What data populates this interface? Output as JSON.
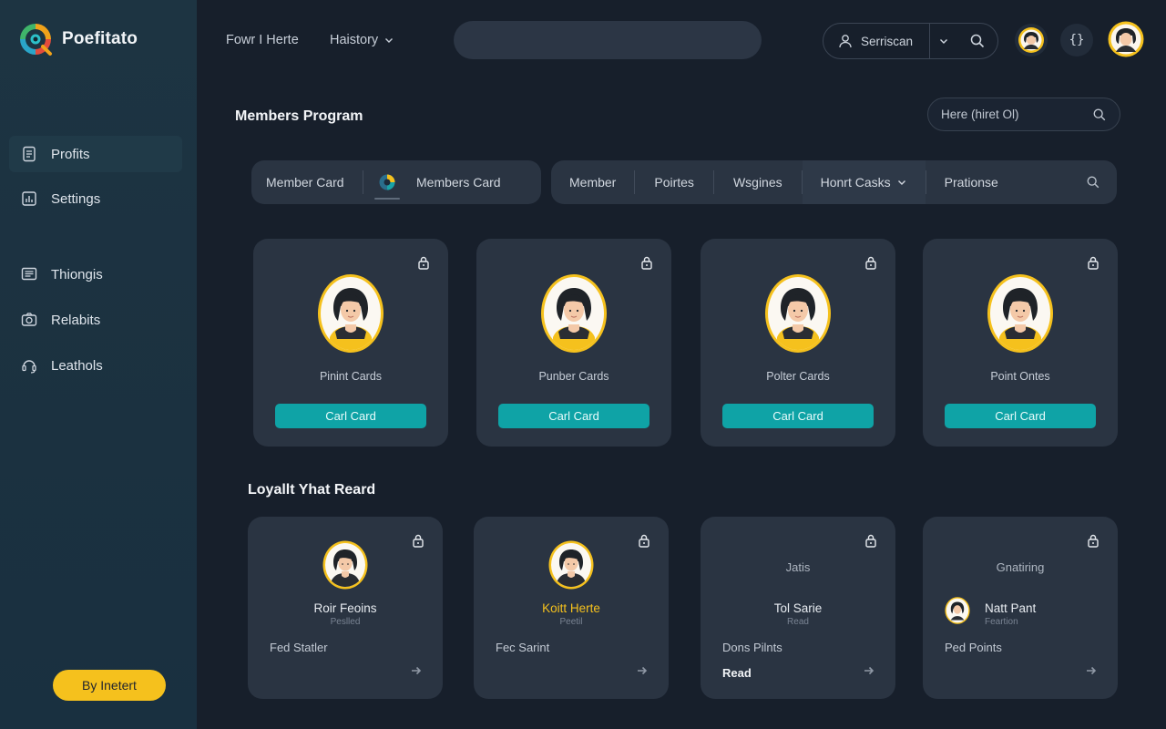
{
  "app": {
    "name": "Poefitato"
  },
  "sidebar": {
    "items": [
      {
        "label": "Profits",
        "icon": "document-icon"
      },
      {
        "label": "Settings",
        "icon": "chart-icon"
      },
      {
        "label": "Thiongis",
        "icon": "list-icon"
      },
      {
        "label": "Relabits",
        "icon": "camera-icon"
      },
      {
        "label": "Leathols",
        "icon": "headset-icon"
      }
    ],
    "cta_label": "By Inetert"
  },
  "topbar": {
    "links": [
      {
        "label": "Fowr I Herte"
      },
      {
        "label": "Haistory",
        "has_dropdown": true
      }
    ],
    "search_placeholder": "",
    "user_label": "Serriscan"
  },
  "section1": {
    "title": "Members Program",
    "search_placeholder": "Here (hiret Ol)",
    "tabs_left": [
      "Member Card",
      "Members Card"
    ],
    "tabs_right": [
      "Member",
      "Poirtes",
      "Wsgines",
      "Honrt Casks",
      "Prationse"
    ]
  },
  "member_cards": [
    {
      "label": "Pinint Cards",
      "button": "Carl Card"
    },
    {
      "label": "Punber Cards",
      "button": "Carl Card"
    },
    {
      "label": "Polter Cards",
      "button": "Carl Card"
    },
    {
      "label": "Point Ontes",
      "button": "Carl Card"
    }
  ],
  "section2": {
    "title": "Loyallt Yhat Reard"
  },
  "loyalty_cards": [
    {
      "top_text": "",
      "name": "Roir Feoins",
      "sub": "Peslled",
      "desc": "Fed Statler",
      "read": "",
      "name_color": "#e8ecf1"
    },
    {
      "top_text": "",
      "name": "Koitt Herte",
      "sub": "Peetil",
      "desc": "Fec Sarint",
      "read": "",
      "name_color": "#f5c11d"
    },
    {
      "top_text": "Jatis",
      "name": "Tol Sarie",
      "sub": "Read",
      "desc": "Dons Pilnts",
      "read": "Read",
      "name_color": "#e8ecf1"
    },
    {
      "top_text": "Gnatiring",
      "name": "Natt Pant",
      "sub": "Feartion",
      "desc": "Ped Points",
      "read": "",
      "name_color": "#e8ecf1"
    }
  ],
  "colors": {
    "accent": "#0fa3a6",
    "yellow": "#f5c11d",
    "card_bg": "#2a3442",
    "page_bg": "#171f2b"
  }
}
